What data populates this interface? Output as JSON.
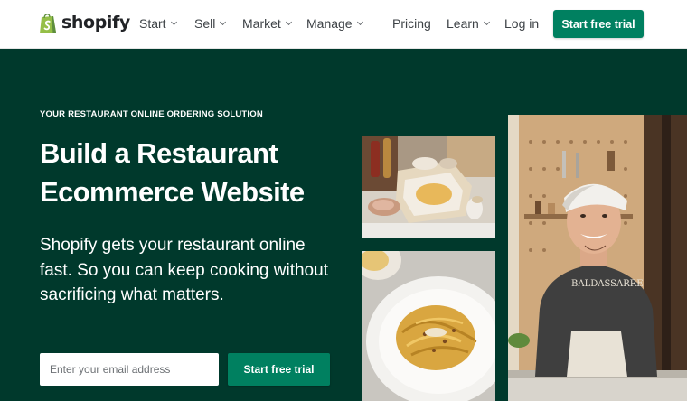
{
  "brand": {
    "name": "shopify",
    "logo_color": "#95bf47"
  },
  "nav": {
    "items": [
      {
        "label": "Start",
        "has_dropdown": true
      },
      {
        "label": "Sell",
        "has_dropdown": true
      },
      {
        "label": "Market",
        "has_dropdown": true
      },
      {
        "label": "Manage",
        "has_dropdown": true
      },
      {
        "label": "Pricing",
        "has_dropdown": false
      },
      {
        "label": "Learn",
        "has_dropdown": true
      },
      {
        "label": "Log in",
        "has_dropdown": false
      }
    ],
    "cta_label": "Start free trial"
  },
  "hero": {
    "eyebrow": "YOUR RESTAURANT ONLINE ORDERING SOLUTION",
    "headline": "Build a Restaurant Ecommerce Website",
    "subtext": "Shopify gets your restaurant online fast. So you can keep cooking without sacrificing what matters.",
    "email_placeholder": "Enter your email address",
    "cta_label": "Start free trial",
    "shirt_text": "BALDASSARRE"
  },
  "colors": {
    "brand_green": "#008060",
    "hero_bg": "#00392c",
    "text_dark": "#212326"
  }
}
